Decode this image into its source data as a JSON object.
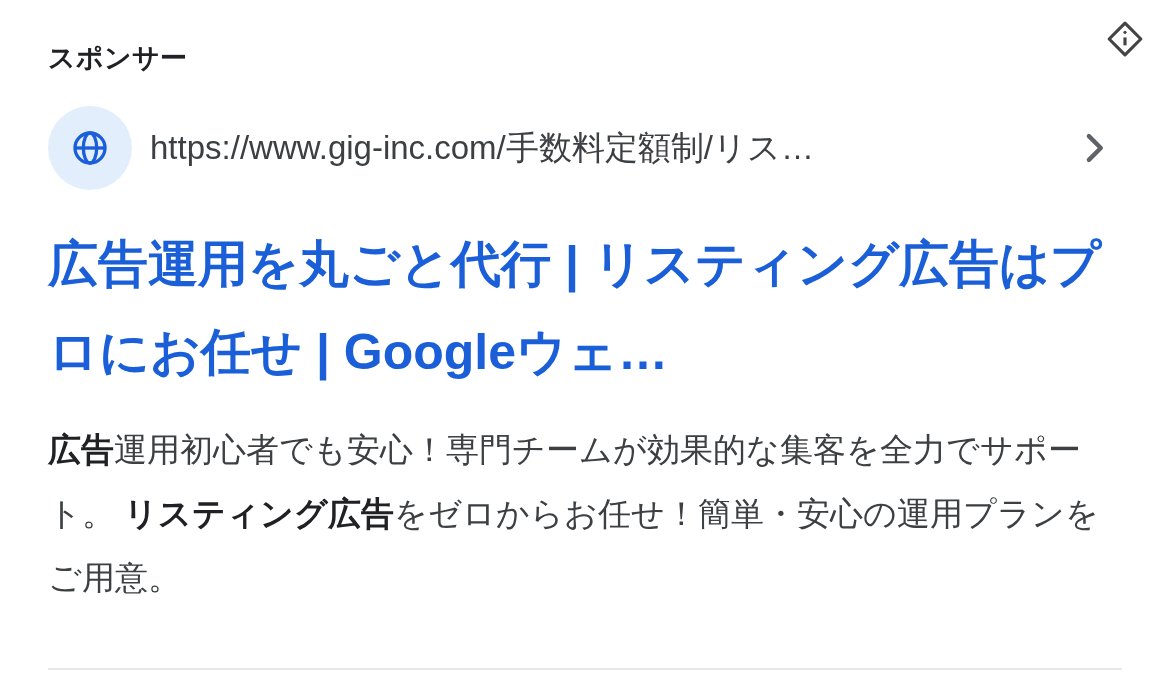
{
  "label": "スポンサー",
  "url": "https://www.gig-inc.com/手数料定額制/リス…",
  "title": "広告運用を丸ごと代行 | リスティング広告はプロにお任せ | Googleウェ…",
  "description": "**広告**運用初心者でも安心！専門チームが効果的な集客を全力でサポート。 **リスティング広告**をゼロからお任せ！簡単・安心の運用プランをご用意。"
}
